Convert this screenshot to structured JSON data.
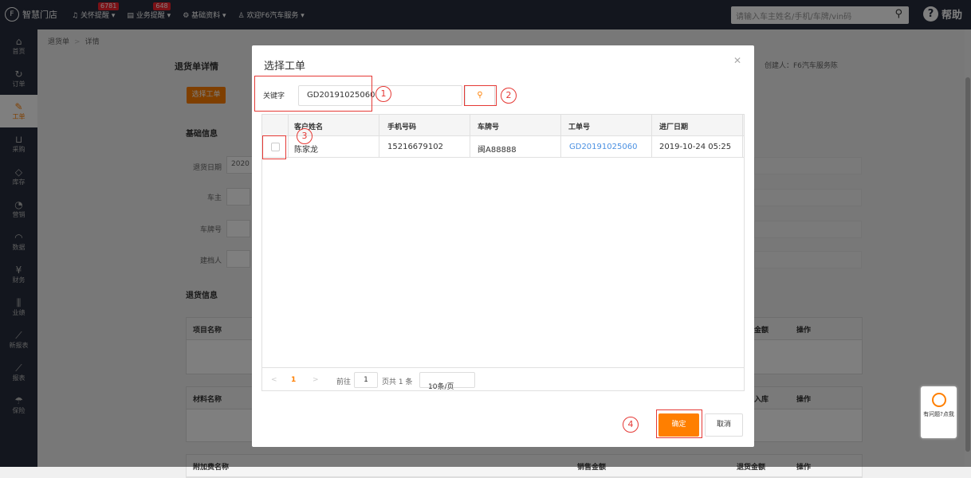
{
  "app": {
    "brand": "智慧门店"
  },
  "topnav": [
    {
      "label": "关怀提醒",
      "badge": "6781",
      "icon": "bell-icon"
    },
    {
      "label": "业务提醒",
      "badge": "648",
      "icon": "list-icon"
    },
    {
      "label": "基础资料",
      "badge": "",
      "icon": "gear-icon"
    },
    {
      "label": "欢迎F6汽车服务",
      "badge": "",
      "icon": "user-icon"
    }
  ],
  "search": {
    "placeholder": "请输入车主姓名/手机/车牌/vin码"
  },
  "help": {
    "label": "帮助"
  },
  "sidebar": {
    "items": [
      {
        "label": "首页",
        "icon": "home-icon"
      },
      {
        "label": "订单",
        "icon": "order-icon"
      },
      {
        "label": "工单",
        "icon": "wrench-icon",
        "active": true
      },
      {
        "label": "采购",
        "icon": "cart-icon"
      },
      {
        "label": "库存",
        "icon": "box-icon"
      },
      {
        "label": "营销",
        "icon": "marketing-icon"
      },
      {
        "label": "数据",
        "icon": "cloud-icon"
      },
      {
        "label": "财务",
        "icon": "yen-icon"
      },
      {
        "label": "业绩",
        "icon": "bar-chart-icon"
      },
      {
        "label": "新报表",
        "icon": "line-chart-icon"
      },
      {
        "label": "报表",
        "icon": "report-icon"
      },
      {
        "label": "保险",
        "icon": "umbrella-icon"
      }
    ]
  },
  "breadcrumb": [
    "退货单",
    "详情"
  ],
  "page": {
    "title": "退货单详情",
    "creator": "创建人：F6汽车服务陈",
    "select_btn": "选择工单",
    "basic_info": "基础信息",
    "return_date_label": "退货日期",
    "return_date_value": "2020",
    "owner_label": "车主",
    "plate_label": "车牌号",
    "filer_label": "建档人",
    "return_info": "退货信息",
    "item_name": "项目名称",
    "material_name": "材料名称",
    "extra_name": "附加费名称",
    "amount": "金额",
    "op": "操作",
    "stock_in": "入库",
    "sale_amount": "销售金额",
    "return_amount": "退货金额"
  },
  "modal": {
    "title": "选择工单",
    "keyword_label": "关键字",
    "keyword_value": "GD20191025060",
    "columns": [
      "客户姓名",
      "手机号码",
      "车牌号",
      "工单号",
      "进厂日期"
    ],
    "rows": [
      {
        "name": "陈家龙",
        "phone": "15216679102",
        "plate": "闽A88888",
        "order": "GD20191025060",
        "date": "2019-10-24 05:25"
      }
    ],
    "pager": {
      "prev": "<",
      "current": "1",
      "next": ">",
      "goto": "前往",
      "goto_val": "1",
      "total": "页共 1 条",
      "size": "10条/页"
    },
    "ok": "确定",
    "cancel": "取消"
  },
  "annotations": [
    "1",
    "2",
    "3",
    "4"
  ],
  "chat": {
    "label": "有问题?点我"
  }
}
